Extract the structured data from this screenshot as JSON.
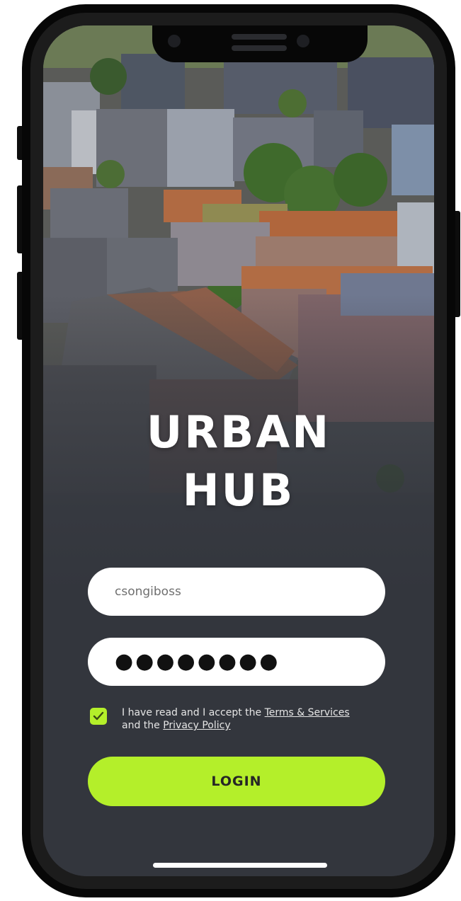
{
  "app": {
    "title_line1": "URBAN",
    "title_line2": "HUB"
  },
  "form": {
    "username_value": "csongiboss",
    "password_masked": "●●●●●●●●",
    "terms": {
      "checked": true,
      "prefix": "I have read and I accept the ",
      "terms_link": "Terms & Services",
      "middle": "and the ",
      "privacy_link": "Privacy Policy"
    },
    "login_label": "LOGIN"
  },
  "icons": {
    "checkbox": "check-icon"
  },
  "colors": {
    "accent": "#b4ef2a",
    "background": "#33363d",
    "field": "#ffffff",
    "text_light": "#e6e6e6"
  }
}
